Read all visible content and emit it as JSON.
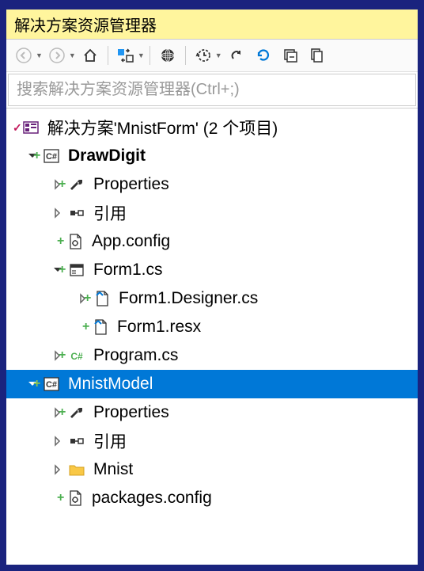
{
  "title": "解决方案资源管理器",
  "search": {
    "placeholder": "搜索解决方案资源管理器(Ctrl+;)"
  },
  "tree": {
    "solution_label": "解决方案'MnistForm' (2 个项目)",
    "project1": {
      "name": "DrawDigit",
      "properties": "Properties",
      "references": "引用",
      "appconfig": "App.config",
      "form1": "Form1.cs",
      "form1_designer": "Form1.Designer.cs",
      "form1_resx": "Form1.resx",
      "program": "Program.cs"
    },
    "project2": {
      "name": "MnistModel",
      "properties": "Properties",
      "references": "引用",
      "mnist": "Mnist",
      "packages": "packages.config"
    }
  }
}
